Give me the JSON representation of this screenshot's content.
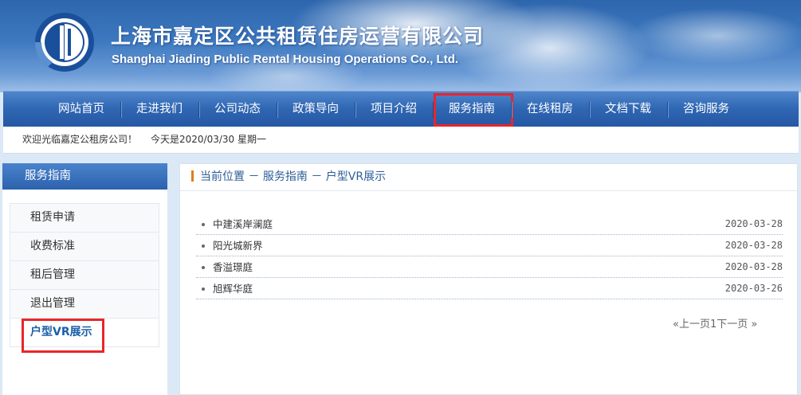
{
  "header": {
    "title_cn": "上海市嘉定区公共租赁住房运营有限公司",
    "title_en": "Shanghai Jiading Public Rental Housing Operations Co., Ltd.",
    "logo_icon": "company-logo-icon",
    "logo_colors": [
      "#1a4f9c",
      "#ffffff"
    ]
  },
  "nav": {
    "items": [
      {
        "label": "网站首页"
      },
      {
        "label": "走进我们"
      },
      {
        "label": "公司动态"
      },
      {
        "label": "政策导向"
      },
      {
        "label": "项目介绍"
      },
      {
        "label": "服务指南"
      },
      {
        "label": "在线租房"
      },
      {
        "label": "文档下载"
      },
      {
        "label": "咨询服务"
      }
    ],
    "highlighted": "服务指南",
    "highlight_color": "#e8262a"
  },
  "welcome": {
    "greeting": "欢迎光临嘉定公租房公司！",
    "date_text": "今天是2020/03/30 星期一"
  },
  "sidebar": {
    "title": "服务指南",
    "items": [
      {
        "label": "租赁申请"
      },
      {
        "label": "收费标准"
      },
      {
        "label": "租后管理"
      },
      {
        "label": "退出管理"
      },
      {
        "label": "户型VR展示"
      }
    ],
    "active": "户型VR展示"
  },
  "breadcrumb": {
    "text": "当前位置 － 服务指南 － 户型VR展示"
  },
  "list": {
    "rows": [
      {
        "title": "中建溪岸澜庭",
        "date": "2020-03-28"
      },
      {
        "title": "阳光城新界",
        "date": "2020-03-28"
      },
      {
        "title": "香溢璟庭",
        "date": "2020-03-28"
      },
      {
        "title": "旭辉华庭",
        "date": "2020-03-26"
      }
    ]
  },
  "pager": {
    "prev": "«上一页",
    "page": "1",
    "next": "下一页 »"
  }
}
